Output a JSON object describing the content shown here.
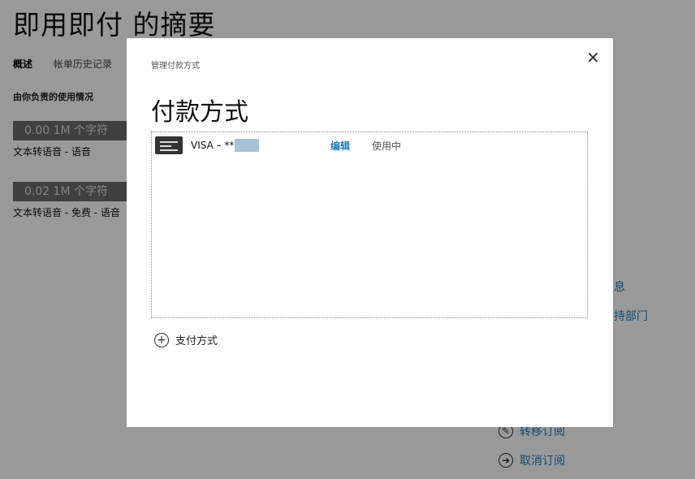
{
  "page": {
    "title": "即用即付 的摘要",
    "tabs": [
      "概述",
      "帐单历史记录"
    ],
    "usage_heading": "由你负责的使用情况",
    "meters": [
      {
        "value": "0.00 1M 个字符",
        "caption": "文本转语音 - 语音"
      },
      {
        "value": "0.02 1M 个字符",
        "caption": "文本转语音 - 免费 - 语音"
      }
    ],
    "side_links": [
      "息",
      "持部门"
    ],
    "actions": [
      {
        "label": "转移订阅",
        "icon": "pencil-icon"
      },
      {
        "label": "取消订阅",
        "icon": "arrow-right-icon"
      }
    ]
  },
  "dialog": {
    "subtitle": "管理付款方式",
    "close_symbol": "✕",
    "heading": "付款方式",
    "methods": [
      {
        "name": "VISA – **",
        "edit_label": "编辑",
        "status": "使用中",
        "icon": "credit-card-icon"
      }
    ],
    "add_label": "支付方式",
    "add_icon": "plus-circle-icon"
  },
  "colors": {
    "link": "#1f7ec1",
    "overlay": "rgba(0,0,0,0.40)",
    "meter_bg": "#6b6b6b"
  }
}
